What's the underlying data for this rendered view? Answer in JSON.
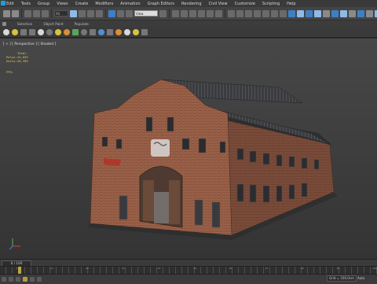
{
  "menubar": {
    "items": [
      "Edit",
      "Tools",
      "Group",
      "Views",
      "Create",
      "Modifiers",
      "Animation",
      "Graph Editors",
      "Rendering",
      "Civil View",
      "Customize",
      "Scripting",
      "Help"
    ]
  },
  "toolbar": {
    "undo_icon": "undo-icon",
    "selection_filter": "All",
    "view_dropdown": "View"
  },
  "ribbon": {
    "tabs": [
      "Selection",
      "Object Paint",
      "Populate"
    ]
  },
  "viewport": {
    "label": "[ + ] [ Perspective ] [ Shaded ]",
    "stats": {
      "header": "Total",
      "polys_label": "Polys:",
      "polys_value": "24,653",
      "verts_label": "Verts:",
      "verts_value": "20,394"
    },
    "fps_label": "FPS:"
  },
  "timeline": {
    "frame_counter": "0 / 100",
    "ticks": [
      "0",
      "10",
      "20",
      "30",
      "40",
      "50",
      "60",
      "70",
      "80",
      "90",
      "100"
    ]
  },
  "status": {
    "grid_value": "Grid = 100,0cm",
    "auto_label": "Auto"
  },
  "colors": {
    "brick": "#8a4a36",
    "roof": "#3e3e40",
    "accent": "#1aa1d6"
  }
}
